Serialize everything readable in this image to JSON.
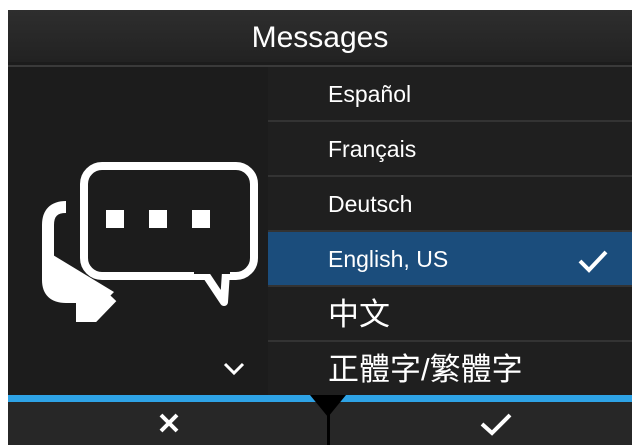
{
  "header": {
    "title": "Messages"
  },
  "languages": {
    "items": [
      {
        "label": "Español",
        "selected": false
      },
      {
        "label": "Français",
        "selected": false
      },
      {
        "label": "Deutsch",
        "selected": false
      },
      {
        "label": "English, US",
        "selected": true
      },
      {
        "label": "中文",
        "selected": false
      },
      {
        "label": "正體字/繁體字",
        "selected": false
      }
    ]
  },
  "icons": {
    "panel": "speech-bubbles-icon",
    "scroll": "chevron-down-icon",
    "cancel": "close-icon",
    "confirm": "checkmark-icon",
    "selected_mark": "checkmark-icon"
  },
  "colors": {
    "background": "#1c1c1c",
    "selected_row": "#1b4d7c",
    "accent_bar": "#2ea3e6",
    "text": "#ffffff"
  }
}
